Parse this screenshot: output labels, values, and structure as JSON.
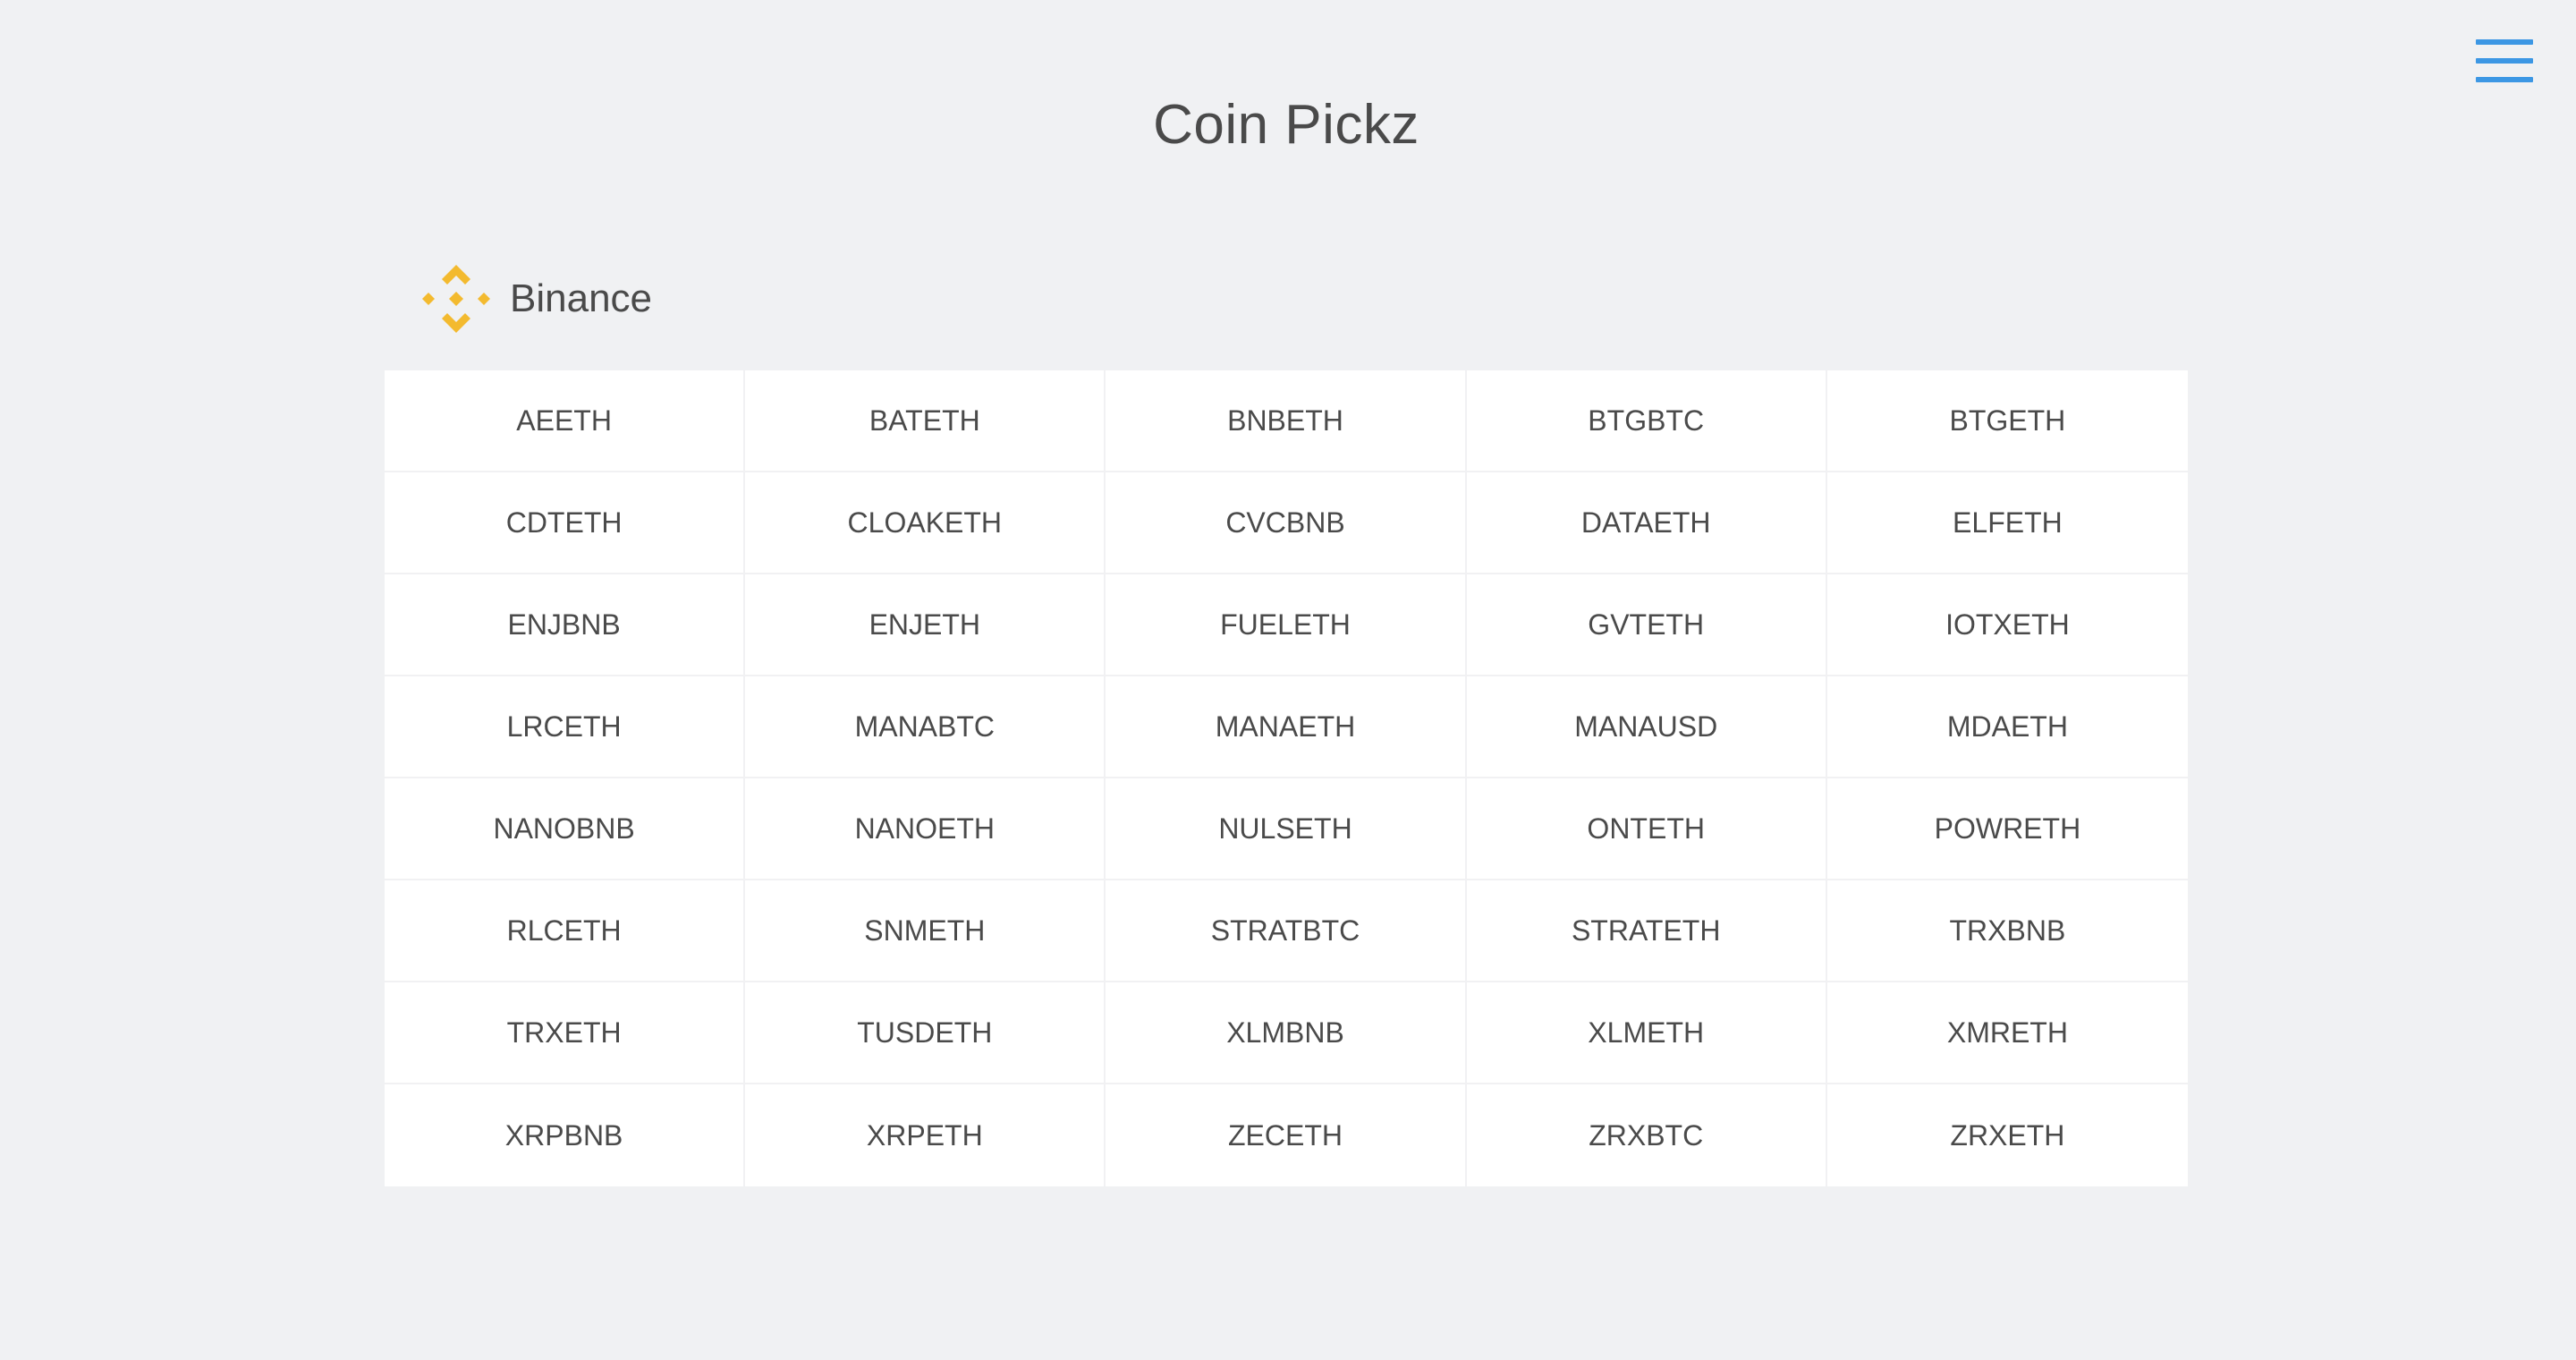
{
  "header": {
    "title": "Coin Pickz",
    "menu_icon": "hamburger-menu-icon",
    "accent_color": "#3c97e4"
  },
  "exchange": {
    "name": "Binance",
    "logo_icon": "binance-logo-icon",
    "logo_color": "#f3ba2f"
  },
  "pairs": [
    "AEETH",
    "BATETH",
    "BNBETH",
    "BTGBTC",
    "BTGETH",
    "CDTETH",
    "CLOAKETH",
    "CVCBNB",
    "DATAETH",
    "ELFETH",
    "ENJBNB",
    "ENJETH",
    "FUELETH",
    "GVTETH",
    "IOTXETH",
    "LRCETH",
    "MANABTC",
    "MANAETH",
    "MANAUSD",
    "MDAETH",
    "NANOBNB",
    "NANOETH",
    "NULSETH",
    "ONTETH",
    "POWRETH",
    "RLCETH",
    "SNMETH",
    "STRATBTC",
    "STRATETH",
    "TRXBNB",
    "TRXETH",
    "TUSDETH",
    "XLMBNB",
    "XLMETH",
    "XMRETH",
    "XRPBNB",
    "XRPETH",
    "ZECETH",
    "ZRXBTC",
    "ZRXETH"
  ]
}
